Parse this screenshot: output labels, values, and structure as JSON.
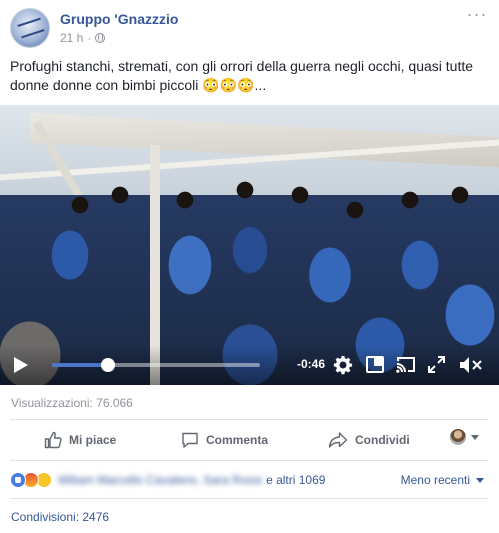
{
  "post": {
    "page_name": "Gruppo 'Gnazzzio",
    "timestamp": "21 h",
    "separator": "·",
    "privacy_icon": "globe-icon",
    "text": "Profughi stanchi, stremati, con gli orrori della guerra negli occhi, quasi tutte donne donne con bimbi piccoli 😳😳😳..."
  },
  "video": {
    "time_remaining": "-0:46",
    "progress_fraction": 0.27,
    "controls": [
      "play-icon",
      "settings-icon",
      "picture-in-picture-icon",
      "cast-icon",
      "expand-icon",
      "mute-icon"
    ]
  },
  "stats": {
    "views": "Visualizzazioni: 76.066",
    "shares": "Condivisioni: 2476"
  },
  "actions": {
    "like": "Mi piace",
    "comment": "Commenta",
    "share": "Condividi"
  },
  "reactions": {
    "icons": [
      "like-reaction-icon",
      "angry-reaction-icon",
      "haha-reaction-icon"
    ],
    "names": "Wiliam Marcello Cavaliere, Sara Rossi",
    "and_others": "e altri 1069",
    "sort_label": "Meno recenti"
  },
  "colors": {
    "link": "#365899",
    "muted": "#90949c",
    "accent": "#4a76c9"
  }
}
